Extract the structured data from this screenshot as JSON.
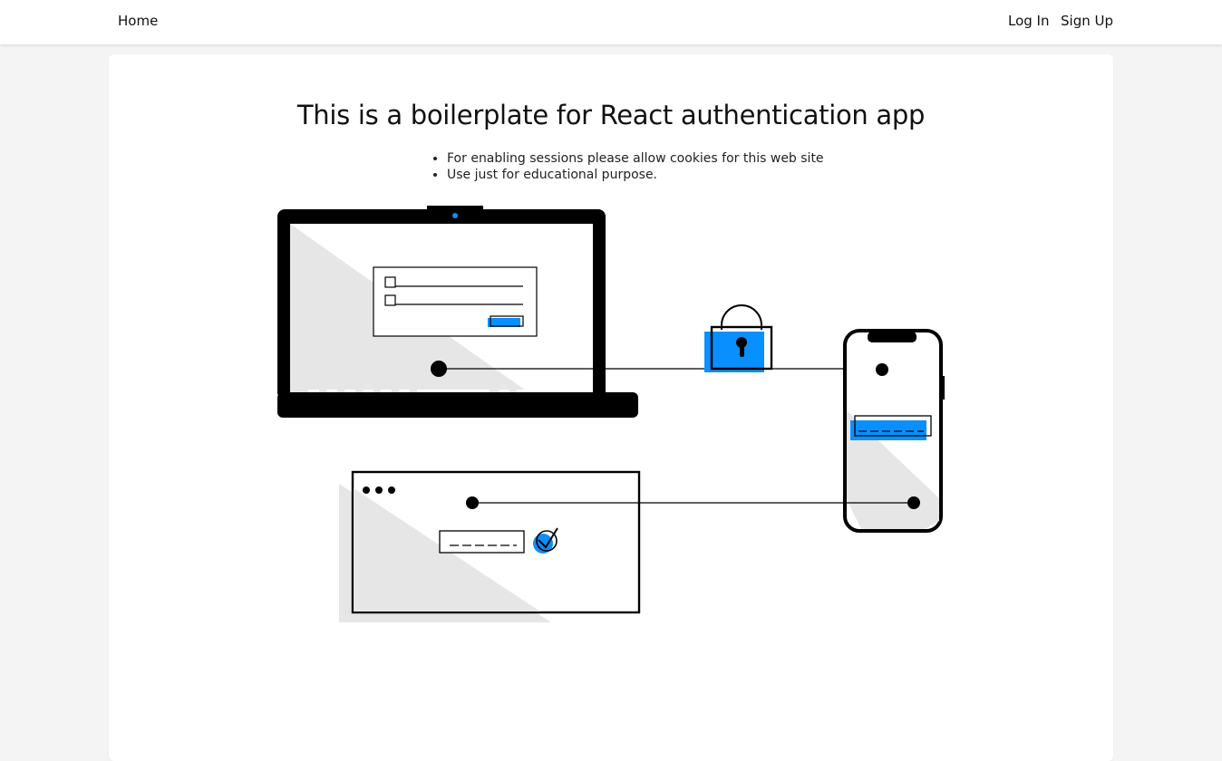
{
  "navbar": {
    "home_label": "Home",
    "login_label": "Log In",
    "signup_label": "Sign Up"
  },
  "main": {
    "title": "This is a boilerplate for React authentication app",
    "notes": [
      "For enabling sessions please allow cookies for this web site",
      "Use just for educational purpose."
    ]
  },
  "illustration": {
    "name": "multi-device-authentication-illustration",
    "accent_color": "#0a8fff",
    "shade_color": "#e6e6e6",
    "stroke_color": "#000000"
  }
}
